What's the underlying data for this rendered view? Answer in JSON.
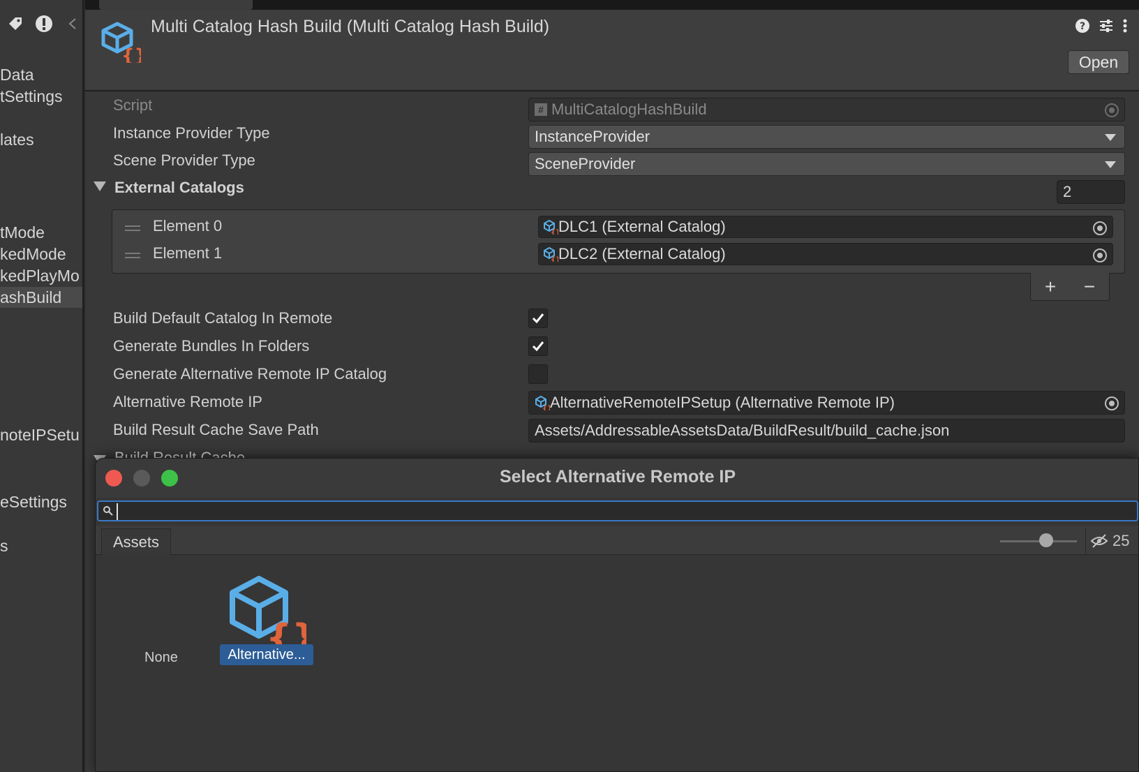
{
  "left_panel": {
    "items": [
      "Data",
      "tSettings",
      "lates",
      "tMode",
      "kedMode",
      "kedPlayMo",
      "ashBuild",
      "noteIPSetu",
      "eSettings",
      "s"
    ],
    "selected_index": 6
  },
  "inspector": {
    "title": "Multi Catalog Hash Build (Multi Catalog Hash Build)",
    "open_label": "Open",
    "fields": {
      "script": {
        "label": "Script",
        "value": "MultiCatalogHashBuild"
      },
      "instance_provider": {
        "label": "Instance Provider Type",
        "value": "InstanceProvider"
      },
      "scene_provider": {
        "label": "Scene Provider Type",
        "value": "SceneProvider"
      },
      "external_catalogs": {
        "label": "External Catalogs",
        "count": "2",
        "elements": [
          {
            "label": "Element 0",
            "value": "DLC1 (External Catalog)"
          },
          {
            "label": "Element 1",
            "value": "DLC2 (External Catalog)"
          }
        ],
        "add": "+",
        "remove": "−"
      },
      "build_default_remote": {
        "label": "Build Default Catalog In Remote",
        "checked": true
      },
      "generate_bundles_folders": {
        "label": "Generate Bundles In Folders",
        "checked": true
      },
      "generate_alt_ip_catalog": {
        "label": "Generate Alternative Remote IP Catalog",
        "checked": false
      },
      "alternative_remote_ip": {
        "label": "Alternative Remote IP",
        "value": "AlternativeRemoteIPSetup (Alternative Remote IP)"
      },
      "build_cache_path": {
        "label": "Build Result Cache Save Path",
        "value": "Assets/AddressableAssetsData/BuildResult/build_cache.json"
      },
      "build_result_cache": {
        "label": "Build Result Cache"
      }
    }
  },
  "picker": {
    "title": "Select Alternative Remote IP",
    "search_value": "",
    "tab": "Assets",
    "zoom": 0.5,
    "hidden_count": "25",
    "items": [
      {
        "label": "None",
        "selected": false
      },
      {
        "label": "Alternative...",
        "selected": true
      }
    ]
  },
  "colors": {
    "accent": "#3a79c6",
    "selection": "#2c5d97",
    "cube_blue": "#5aaee8",
    "brace_orange": "#e0643c",
    "close": "#ee5a52",
    "minimize": "#5a5a5a",
    "maximize": "#3ec148"
  }
}
